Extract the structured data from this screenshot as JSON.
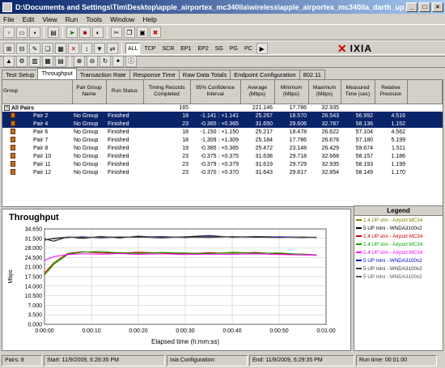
{
  "window": {
    "title": "D:\\Documents and Settings\\Tim\\Desktop\\apple_airportex_mc340lla\\wireless\\apple_airportex_mc340lla_darth_up_4stream..."
  },
  "menu": [
    "File",
    "Edit",
    "View",
    "Run",
    "Tools",
    "Window",
    "Help"
  ],
  "toolbar2": {
    "all": "ALL",
    "tcp": "TCP",
    "scr": "SCR",
    "ep1": "EP1",
    "ep2": "EP2",
    "sg": "SG",
    "pg": "PG",
    "pc": "PC",
    "brand": "IXIA"
  },
  "tabs": [
    "Test Setup",
    "Throughput",
    "Transaction Rate",
    "Response Time",
    "Raw Data Totals",
    "Endpoint Configuration",
    "802.11"
  ],
  "table": {
    "headers": [
      "Group",
      "Pair Group Name",
      "Run Status",
      "Timing Records Completed",
      "95% Confidence Interval",
      "Average (Mbps)",
      "Minimum (Mbps)",
      "Maximum (Mbps)",
      "Measured Time (sec)",
      "Relative Precision"
    ],
    "summary": {
      "label": "All Pairs",
      "records": "165",
      "average": "221.146",
      "minimum": "17.786",
      "maximum": "32.935"
    },
    "rows": [
      {
        "pair": "Pair 2",
        "group": "No Group",
        "status": "Finished",
        "records": "18",
        "ci": "-1.141 : +1.141",
        "avg": "25.267",
        "min": "18.570",
        "max": "26.543",
        "time": "56.992",
        "prec": "4.516",
        "sel": true
      },
      {
        "pair": "Pair 4",
        "group": "No Group",
        "status": "Finished",
        "records": "23",
        "ci": "-0.365 : +0.365",
        "avg": "31.650",
        "min": "29.606",
        "max": "32.787",
        "time": "58.136",
        "prec": "1.152",
        "sel": true
      },
      {
        "pair": "Pair 6",
        "group": "No Group",
        "status": "Finished",
        "records": "18",
        "ci": "-1.150 : +1.150",
        "avg": "25.217",
        "min": "18.478",
        "max": "26.622",
        "time": "57.104",
        "prec": "4.562",
        "sel": false
      },
      {
        "pair": "Pair 7",
        "group": "No Group",
        "status": "Finished",
        "records": "18",
        "ci": "-1.309 : +1.309",
        "avg": "25.184",
        "min": "17.786",
        "max": "26.676",
        "time": "57.180",
        "prec": "5.199",
        "sel": false
      },
      {
        "pair": "Pair 8",
        "group": "No Group",
        "status": "Finished",
        "records": "19",
        "ci": "-0.385 : +0.385",
        "avg": "25.472",
        "min": "23.148",
        "max": "26.429",
        "time": "59.674",
        "prec": "1.511",
        "sel": false
      },
      {
        "pair": "Pair 10",
        "group": "No Group",
        "status": "Finished",
        "records": "23",
        "ci": "-0.375 : +0.375",
        "avg": "31.638",
        "min": "29.718",
        "max": "32.668",
        "time": "58.157",
        "prec": "1.186",
        "sel": false
      },
      {
        "pair": "Pair 11",
        "group": "No Group",
        "status": "Finished",
        "records": "23",
        "ci": "-0.379 : +0.379",
        "avg": "31.619",
        "min": "29.729",
        "max": "32.935",
        "time": "58.193",
        "prec": "1.199",
        "sel": false
      },
      {
        "pair": "Pair 12",
        "group": "No Group",
        "status": "Finished",
        "records": "23",
        "ci": "-0.370 : +0.370",
        "avg": "31.643",
        "min": "29.817",
        "max": "32.854",
        "time": "58.149",
        "prec": "1.170",
        "sel": false
      }
    ]
  },
  "chart_data": {
    "type": "line",
    "title": "Throughput",
    "xlabel": "Elapsed time (h:mm:ss)",
    "ylabel": "Mbps",
    "xticks": [
      "0:00:00",
      "0:00:10",
      "0:00:20",
      "0:00:30",
      "0:00:40",
      "0:00:50",
      "0:01:00"
    ],
    "yticks": [
      "0.000",
      "3.500",
      "7.000",
      "10.500",
      "14.000",
      "17.500",
      "21.000",
      "24.500",
      "28.000",
      "31.500",
      "34.650"
    ],
    "xlim": [
      0,
      60
    ],
    "ylim": [
      0,
      34.65
    ],
    "grid": true,
    "series": [
      {
        "name": "2.4 UP stm - Airport MC34",
        "color": "#808000",
        "x": [
          0,
          2,
          5,
          8,
          12,
          16,
          20,
          25,
          30,
          35,
          40,
          45,
          50,
          55,
          58
        ],
        "y": [
          18.6,
          22.5,
          25.8,
          26.3,
          25.9,
          26.1,
          25.7,
          26.0,
          25.8,
          25.6,
          26.2,
          25.9,
          25.7,
          25.4,
          25.1
        ]
      },
      {
        "name": "5 UP mini - WNDA3100v2",
        "color": "#000000",
        "x": [
          0,
          2,
          5,
          8,
          12,
          16,
          20,
          25,
          30,
          35,
          40,
          45,
          50,
          55,
          58
        ],
        "y": [
          31.0,
          30.2,
          31.8,
          31.2,
          31.9,
          31.4,
          32.0,
          31.5,
          31.8,
          32.2,
          31.6,
          31.9,
          31.7,
          31.5,
          31.6
        ]
      },
      {
        "name": "2.4 UP stm - Airport MC34",
        "color": "#cc0000",
        "x": [
          0,
          2,
          5,
          8,
          12,
          16,
          20,
          25,
          30,
          35,
          40,
          45,
          50,
          55,
          58
        ],
        "y": [
          18.5,
          22.0,
          25.6,
          26.4,
          26.0,
          25.8,
          26.2,
          25.9,
          25.7,
          26.0,
          25.8,
          26.1,
          25.6,
          25.5,
          25.2
        ]
      },
      {
        "name": "2.4 UP stm - Airport MC34",
        "color": "#00aa00",
        "x": [
          0,
          2,
          5,
          8,
          12,
          16,
          20,
          25,
          30,
          35,
          40,
          45,
          50,
          55,
          58
        ],
        "y": [
          17.8,
          21.8,
          25.4,
          26.2,
          26.5,
          25.9,
          25.8,
          26.1,
          25.9,
          25.7,
          26.0,
          25.8,
          25.9,
          25.4,
          25.0
        ]
      },
      {
        "name": "2.4 UP stm - Airport MC34",
        "color": "#ff00ff",
        "x": [
          0,
          2,
          5,
          8,
          12,
          16,
          20,
          25,
          30,
          35,
          40,
          45,
          50,
          55,
          58
        ],
        "y": [
          23.2,
          24.6,
          25.3,
          25.6,
          25.5,
          25.7,
          25.4,
          25.6,
          25.3,
          25.5,
          25.4,
          25.6,
          25.3,
          25.2,
          25.1
        ]
      },
      {
        "name": "5 UP mini - WNDA3100v2",
        "color": "#0000cc",
        "x": [
          0,
          2,
          5,
          8,
          12,
          16,
          20,
          25,
          30,
          35,
          40,
          45,
          50,
          55,
          58
        ],
        "y": [
          30.5,
          31.2,
          31.5,
          31.8,
          31.4,
          31.7,
          31.6,
          31.9,
          31.5,
          31.8,
          31.7,
          31.6,
          31.8,
          31.6,
          31.5
        ]
      },
      {
        "name": "5 UP mini - WNDA3100v2",
        "color": "#333333",
        "x": [
          0,
          2,
          5,
          8,
          12,
          16,
          20,
          25,
          30,
          35,
          40,
          45,
          50,
          55,
          58
        ],
        "y": [
          30.8,
          31.0,
          31.6,
          31.5,
          31.8,
          31.6,
          31.7,
          31.4,
          31.8,
          31.6,
          31.9,
          31.6,
          31.5,
          31.7,
          31.6
        ]
      },
      {
        "name": "5 UP mini - WNDA3100v2",
        "color": "#555555",
        "x": [
          0,
          2,
          5,
          8,
          12,
          16,
          20,
          25,
          30,
          35,
          40,
          45,
          50,
          55,
          58
        ],
        "y": [
          30.6,
          31.3,
          31.7,
          31.6,
          31.5,
          31.8,
          31.6,
          31.7,
          31.6,
          31.5,
          31.8,
          31.7,
          31.6,
          31.5,
          31.6
        ]
      }
    ]
  },
  "legend": {
    "title": "Legend",
    "items": [
      {
        "label": "2.4 UP stm - Airport MC34",
        "color": "#808000"
      },
      {
        "label": "5 UP mini - WNDA3100v2",
        "color": "#000000"
      },
      {
        "label": "2.4 UP stm - Airport MC34",
        "color": "#cc0000"
      },
      {
        "label": "2.4 UP stm - Airport MC34",
        "color": "#00aa00"
      },
      {
        "label": "2.4 UP stm - Airport MC34",
        "color": "#ff00ff"
      },
      {
        "label": "5 UP mini - WNDA3100v2",
        "color": "#0000cc"
      },
      {
        "label": "5 UP mini - WNDA3100v2",
        "color": "#333333"
      },
      {
        "label": "5 UP mini - WNDA3100v2",
        "color": "#555555"
      }
    ]
  },
  "status": {
    "pairs": "Pairs: 8",
    "start": "Start: 11/9/2009, 6:28:35 PM",
    "ixia": "Ixia Configuration:",
    "end": "End: 11/9/2009, 6:29:35 PM",
    "runtime": "Run time: 00:01:00"
  }
}
